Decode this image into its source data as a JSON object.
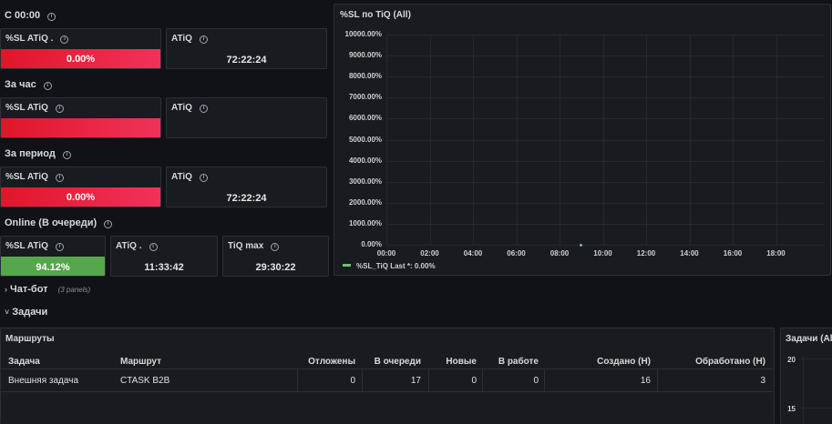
{
  "rows": {
    "since_midnight": "С 00:00",
    "per_hour": "За час",
    "per_period": "За период",
    "online": "Online (В очереди)",
    "chatbot": "Чат-бот",
    "chatbot_panels": "(3 panels)",
    "tasks": "Задачи"
  },
  "stats": {
    "s1_sl": {
      "title": "%SL ATiQ .",
      "value": "0.00%"
    },
    "s1_atiq": {
      "title": "ATiQ",
      "value": "72:22:24"
    },
    "s2_sl": {
      "title": "%SL ATiQ",
      "value": ""
    },
    "s2_atiq": {
      "title": "ATiQ",
      "value": ""
    },
    "s3_sl": {
      "title": "%SL ATiQ",
      "value": "0.00%"
    },
    "s3_atiq": {
      "title": "ATiQ",
      "value": "72:22:24"
    },
    "s4_sl": {
      "title": "%SL ATiQ",
      "value": "94.12%"
    },
    "s4_atiq": {
      "title": "ATiQ .",
      "value": "11:33:42"
    },
    "s4_tiqmax": {
      "title": "TiQ max",
      "value": "29:30:22"
    }
  },
  "colors": {
    "red": "#e0162a",
    "green": "#56a64b",
    "panel_bg": "#181b1f",
    "page_bg": "#111217"
  },
  "chart_data": {
    "type": "line",
    "title": "%SL по TiQ (All)",
    "y_ticks": [
      "10000.00%",
      "9000.00%",
      "8000.00%",
      "7000.00%",
      "6000.00%",
      "5000.00%",
      "4000.00%",
      "3000.00%",
      "2000.00%",
      "1000.00%",
      "0.00%"
    ],
    "x_ticks": [
      "00:00",
      "02:00",
      "04:00",
      "06:00",
      "08:00",
      "10:00",
      "12:00",
      "14:00",
      "16:00",
      "18:00"
    ],
    "ylim": [
      0,
      10000
    ],
    "grid": true,
    "legend_placement": "bottom-left",
    "series": [
      {
        "name": "%SL_TiQ",
        "color": "#73bf69",
        "points": [
          {
            "x": "09:00",
            "y": 0
          }
        ]
      }
    ],
    "legend_text": "%SL_TiQ  Last *: 0.00%"
  },
  "table": {
    "title": "Маршруты",
    "headers": [
      "Задача",
      "Маршрут",
      "Отложены",
      "В очереди",
      "Новые",
      "В работе",
      "Создано (Н)",
      "Обработано (Н)"
    ],
    "rows": [
      [
        "Внешняя задача",
        "CTASK B2B",
        "0",
        "17",
        "0",
        "0",
        "16",
        "3"
      ]
    ]
  },
  "side_panel": {
    "title": "Задачи (All",
    "y_ticks": [
      "20",
      "15"
    ]
  }
}
